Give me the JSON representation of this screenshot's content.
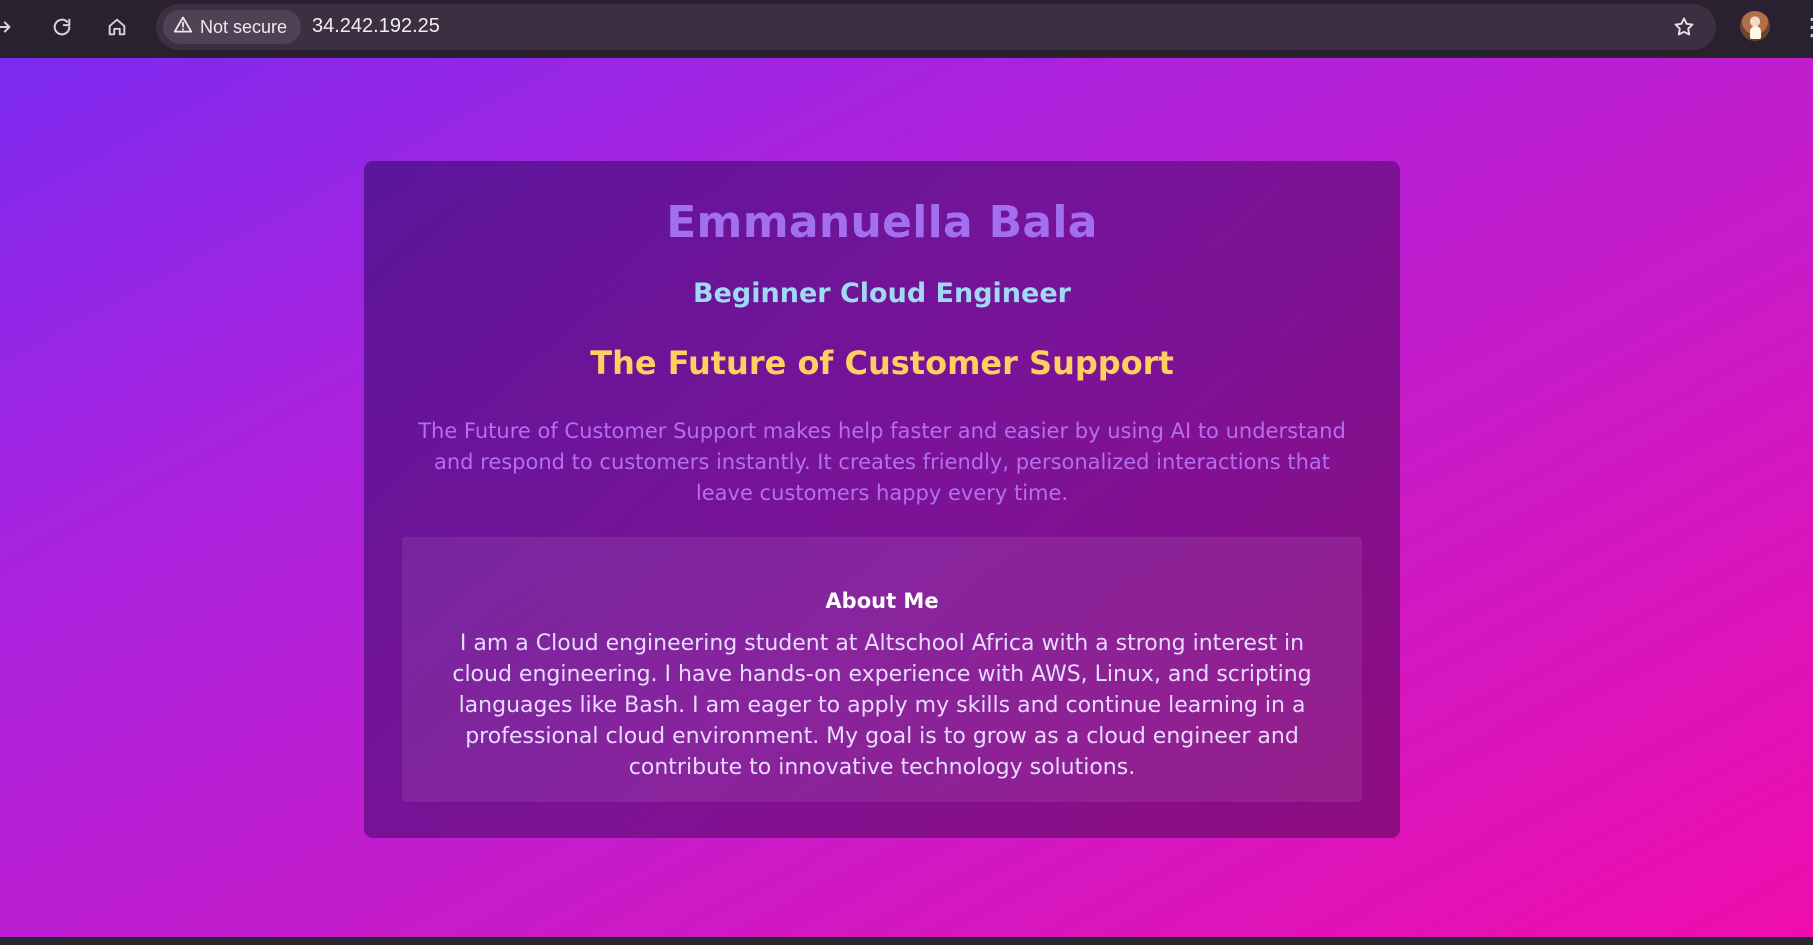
{
  "browser": {
    "security_label": "Not secure",
    "url": "34.242.192.25",
    "icons": {
      "forward": "forward-arrow-icon",
      "reload": "reload-icon",
      "home": "home-icon",
      "warning": "warning-icon",
      "bookmark": "star-icon",
      "profile": "profile-avatar",
      "menu": "more-menu-icon"
    }
  },
  "page": {
    "name": "Emmanuella Bala",
    "role": "Beginner Cloud Engineer",
    "project_title": "The Future of Customer Support",
    "project_description": "The Future of Customer Support makes help faster and easier by using AI to understand and respond to customers instantly. It creates friendly, personalized interactions that leave customers happy every time.",
    "about": {
      "heading": "About Me",
      "text": "I am a Cloud engineering student at Altschool Africa with a strong interest in cloud engineering. I have hands-on experience with AWS, Linux, and scripting languages like Bash. I am eager to apply my skills and continue learning in a professional cloud environment. My goal is to grow as a cloud engineer and contribute to innovative technology solutions."
    }
  },
  "colors": {
    "toolbar": "#2a2130",
    "omnibox": "#3c2f41",
    "gradient_start": "#7c2af0",
    "gradient_end": "#ef0dac",
    "name": "#a36ff0",
    "role": "#9fd9f3",
    "project_title": "#ffcf62",
    "project_description": "#b56ef0"
  }
}
